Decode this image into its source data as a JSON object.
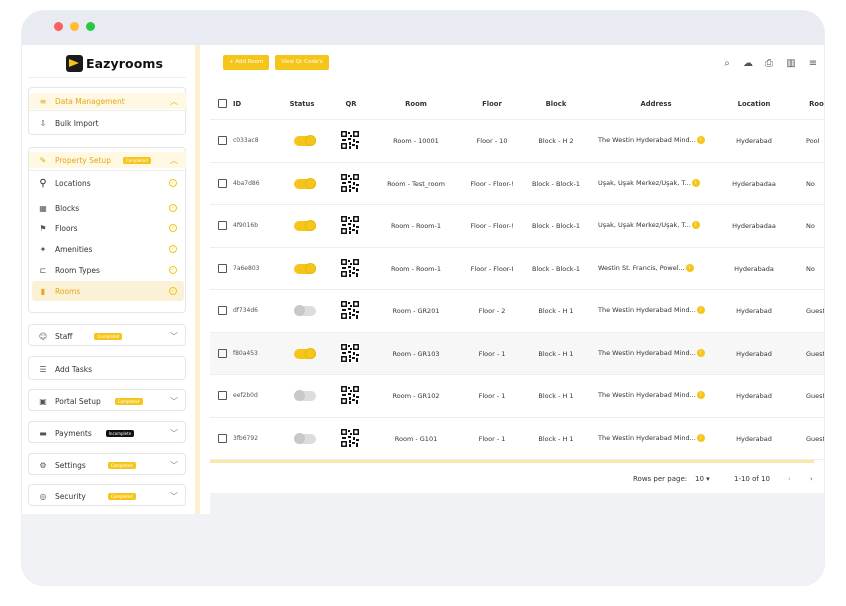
{
  "app": {
    "name": "Eazyrooms"
  },
  "colors": {
    "accent": "#f6c51a",
    "window_red": "#fe5f57",
    "window_yellow": "#febc2e",
    "window_green": "#28c840"
  },
  "sidebar": {
    "data_management": {
      "label": "Data Management",
      "icon": "database-icon"
    },
    "bulk_import": {
      "label": "Bulk Import",
      "icon": "import-icon"
    },
    "property_setup": {
      "label": "Property Setup",
      "badge": "Completed",
      "icon": "wrench-icon"
    },
    "property_items": [
      {
        "label": "Locations",
        "icon": "location-pin-icon"
      },
      {
        "label": "Blocks",
        "icon": "building-icon"
      },
      {
        "label": "Floors",
        "icon": "flag-icon"
      },
      {
        "label": "Amenities",
        "icon": "amenities-icon"
      },
      {
        "label": "Room Types",
        "icon": "bed-icon"
      },
      {
        "label": "Rooms",
        "icon": "room-icon"
      }
    ],
    "staff": {
      "label": "Staff",
      "badge": "Completed",
      "icon": "staff-icon"
    },
    "add_tasks": {
      "label": "Add Tasks",
      "icon": "tasks-icon"
    },
    "portal_setup": {
      "label": "Portal Setup",
      "badge": "Completed",
      "icon": "portal-icon"
    },
    "payments": {
      "label": "Payments",
      "badge": "Incomplete",
      "icon": "card-icon"
    },
    "settings": {
      "label": "Settings",
      "badge": "Completed",
      "icon": "gear-icon"
    },
    "security": {
      "label": "Security",
      "badge": "Completed",
      "icon": "globe-icon"
    }
  },
  "toolbar": {
    "add_room": "+ Add Room",
    "view_qr": "View Qr Code's"
  },
  "table": {
    "headers": [
      "ID",
      "Status",
      "QR",
      "Room",
      "Floor",
      "Block",
      "Address",
      "Location",
      "Room"
    ],
    "rows": [
      {
        "id": "c033ac8",
        "status": "on",
        "room": "Room - 10001",
        "floor": "Floor - 10",
        "block": "Block - H 2",
        "address": "The Westin Hyderabad Mind...",
        "location": "Hyderabad",
        "room_type": "Pool"
      },
      {
        "id": "4ba7d86",
        "status": "on",
        "room": "Room - Test_room",
        "floor": "Floor - Floor-!",
        "block": "Block - Block-1",
        "address": "Uşak, Uşak Merkez/Uşak, T...",
        "location": "Hyderabadaa",
        "room_type": "No"
      },
      {
        "id": "4f9016b",
        "status": "on",
        "room": "Room - Room-1",
        "floor": "Floor - Floor-!",
        "block": "Block - Block-1",
        "address": "Uşak, Uşak Merkez/Uşak, T...",
        "location": "Hyderabadaa",
        "room_type": "No"
      },
      {
        "id": "7a6e803",
        "status": "on",
        "room": "Room - Room-1",
        "floor": "Floor - Floor-I",
        "block": "Block - Block-1",
        "address": "Westin St. Francis, Powel...",
        "location": "Hyderabada",
        "room_type": "No"
      },
      {
        "id": "df734d6",
        "status": "off",
        "room": "Room - GR201",
        "floor": "Floor - 2",
        "block": "Block - H 1",
        "address": "The Westin Hyderabad Mind...",
        "location": "Hyderabad",
        "room_type": "Guest"
      },
      {
        "id": "f80a453",
        "status": "on",
        "room": "Room - GR103",
        "floor": "Floor - 1",
        "block": "Block - H 1",
        "address": "The Westin Hyderabad Mind...",
        "location": "Hyderabad",
        "room_type": "Guest"
      },
      {
        "id": "eef2b0d",
        "status": "off",
        "room": "Room - GR102",
        "floor": "Floor - 1",
        "block": "Block - H 1",
        "address": "The Westin Hyderabad Mind...",
        "location": "Hyderabad",
        "room_type": "Guest"
      },
      {
        "id": "3fb6792",
        "status": "off",
        "room": "Room - G101",
        "floor": "Floor - 1",
        "block": "Block - H 1",
        "address": "The Westin Hyderabad Mind...",
        "location": "Hyderabad",
        "room_type": "Guest"
      }
    ]
  },
  "pagination": {
    "rows_per_page_label": "Rows per page:",
    "rows_per_page": "10",
    "range": "1-10 of 10"
  }
}
